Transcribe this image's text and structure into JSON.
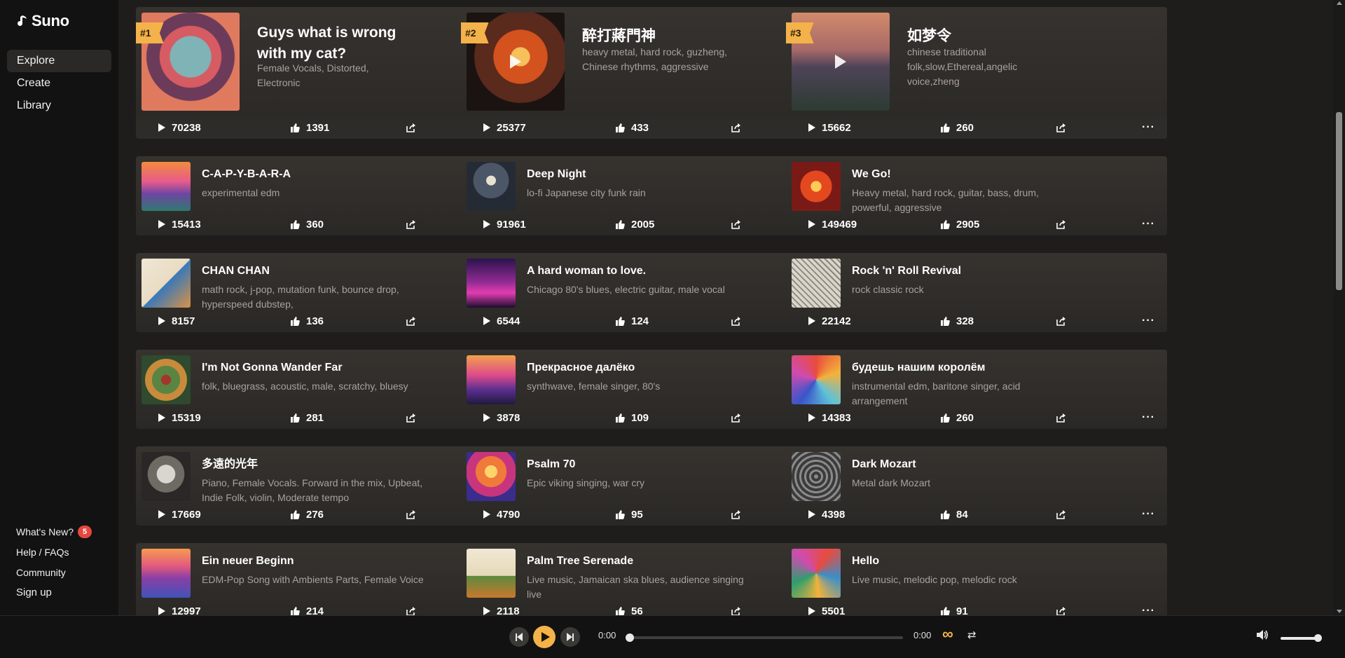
{
  "brand": {
    "name": "Suno"
  },
  "nav": [
    {
      "label": "Explore",
      "active": true
    },
    {
      "label": "Create",
      "active": false
    },
    {
      "label": "Library",
      "active": false
    }
  ],
  "footer": {
    "whats_new": "What's New?",
    "whats_new_badge": "5",
    "help": "Help / FAQs",
    "community": "Community",
    "signup": "Sign up"
  },
  "trending": [
    {
      "rank": "#1",
      "title": "Guys what is wrong with my cat?",
      "tags": "Female Vocals, Distorted, Electronic",
      "plays": "70238",
      "likes": "1391",
      "cover": "cat"
    },
    {
      "rank": "#2",
      "title": "醉打蔣門神",
      "tags": "heavy metal, hard rock, guzheng, Chinese rhythms, aggressive",
      "plays": "25377",
      "likes": "433",
      "cover": "dragon"
    },
    {
      "rank": "#3",
      "title": "如梦令",
      "tags": "chinese traditional folk,slow,Ethereal,angelic voice,zheng",
      "plays": "15662",
      "likes": "260",
      "cover": "lotus"
    }
  ],
  "songs": [
    {
      "title": "C-A-P-Y-B-A-R-A",
      "tags": "experimental edm",
      "plays": "15413",
      "likes": "360",
      "cover": "sunset"
    },
    {
      "title": "Deep Night",
      "tags": "lo-fi Japanese city funk rain",
      "plays": "91961",
      "likes": "2005",
      "cover": "night"
    },
    {
      "title": "We Go!",
      "tags": "Heavy metal, hard rock, guitar, bass, drum, powerful, aggressive",
      "plays": "149469",
      "likes": "2905",
      "cover": "phoenix"
    },
    {
      "title": "CHAN CHAN",
      "tags": "math rock, j-pop, mutation funk, bounce drop, hyperspeed dubstep,",
      "plays": "8157",
      "likes": "136",
      "cover": "bird"
    },
    {
      "title": "A hard woman to love.",
      "tags": "Chicago 80's blues, electric guitar, male vocal",
      "plays": "6544",
      "likes": "124",
      "cover": "city"
    },
    {
      "title": "Rock 'n' Roll Revival",
      "tags": "rock classic rock",
      "plays": "22142",
      "likes": "328",
      "cover": "sketch"
    },
    {
      "title": "I'm Not Gonna Wander Far",
      "tags": "folk, bluegrass, acoustic, male, scratchy, bluesy",
      "plays": "15319",
      "likes": "281",
      "cover": "floral"
    },
    {
      "title": "Прекрасное далёко",
      "tags": "synthwave, female singer, 80's",
      "plays": "3878",
      "likes": "109",
      "cover": "synth"
    },
    {
      "title": "будешь нашим королём",
      "tags": "instrumental edm, baritone singer, acid arrangement",
      "plays": "14383",
      "likes": "260",
      "cover": "burst"
    },
    {
      "title": "多遠的光年",
      "tags": "Piano, Female Vocals. Forward in the mix, Upbeat, Indie Folk, violin, Moderate tempo",
      "plays": "17669",
      "likes": "276",
      "cover": "moon"
    },
    {
      "title": "Psalm 70",
      "tags": "Epic viking singing, war cry",
      "plays": "4790",
      "likes": "95",
      "cover": "psalm"
    },
    {
      "title": "Dark Mozart",
      "tags": "Metal dark Mozart",
      "plays": "4398",
      "likes": "84",
      "cover": "pattern"
    },
    {
      "title": "Ein neuer Beginn",
      "tags": "EDM-Pop Song with Ambients Parts, Female Voice",
      "plays": "12997",
      "likes": "214",
      "cover": "hills"
    },
    {
      "title": "Palm Tree Serenade",
      "tags": "Live music, Jamaican ska blues, audience singing live",
      "plays": "2118",
      "likes": "56",
      "cover": "palm"
    },
    {
      "title": "Hello",
      "tags": "Live music, melodic pop, melodic rock",
      "plays": "5501",
      "likes": "91",
      "cover": "collage"
    }
  ],
  "player": {
    "current_time": "0:00",
    "duration": "0:00",
    "progress": 0,
    "volume": 0.95
  },
  "colors": {
    "accent": "#f4b24a",
    "badge": "#e5483f"
  }
}
